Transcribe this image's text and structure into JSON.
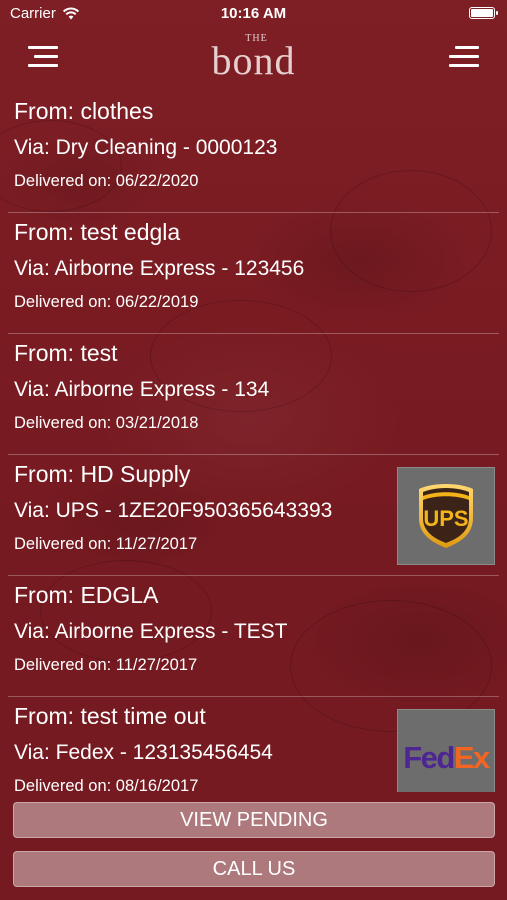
{
  "status": {
    "carrier": "Carrier",
    "time": "10:16 AM",
    "battery_level": 1.0
  },
  "header": {
    "logo_small": "THE",
    "logo_main": "bond"
  },
  "deliveries": [
    {
      "from": "From: clothes",
      "via": "Via: Dry Cleaning - 0000123",
      "delivered": "Delivered on: 06/22/2020",
      "logo": null
    },
    {
      "from": "From: test edgla",
      "via": "Via: Airborne Express - 123456",
      "delivered": "Delivered on: 06/22/2019",
      "logo": null
    },
    {
      "from": "From: test",
      "via": "Via: Airborne Express - 134",
      "delivered": "Delivered on: 03/21/2018",
      "logo": null
    },
    {
      "from": "From: HD Supply",
      "via": "Via: UPS - 1ZE20F950365643393",
      "delivered": "Delivered on: 11/27/2017",
      "logo": "ups-logo"
    },
    {
      "from": "From: EDGLA",
      "via": "Via: Airborne Express - TEST",
      "delivered": "Delivered on: 11/27/2017",
      "logo": null
    },
    {
      "from": "From: test time out",
      "via": "Via: Fedex - 123135456454",
      "delivered": "Delivered on: 08/16/2017",
      "logo": "fedex-logo"
    }
  ],
  "logos": {
    "ups_text": "UPS",
    "fedex_fe": "Fed",
    "fedex_ex": "Ex"
  },
  "buttons": {
    "view_pending": "VIEW PENDING",
    "call_us": "CALL US"
  },
  "colors": {
    "background": "#7a1b22",
    "ups_brown": "#3b2417",
    "ups_gold": "#f5b31a",
    "fedex_purple": "#4d2691",
    "fedex_orange": "#f26522"
  }
}
